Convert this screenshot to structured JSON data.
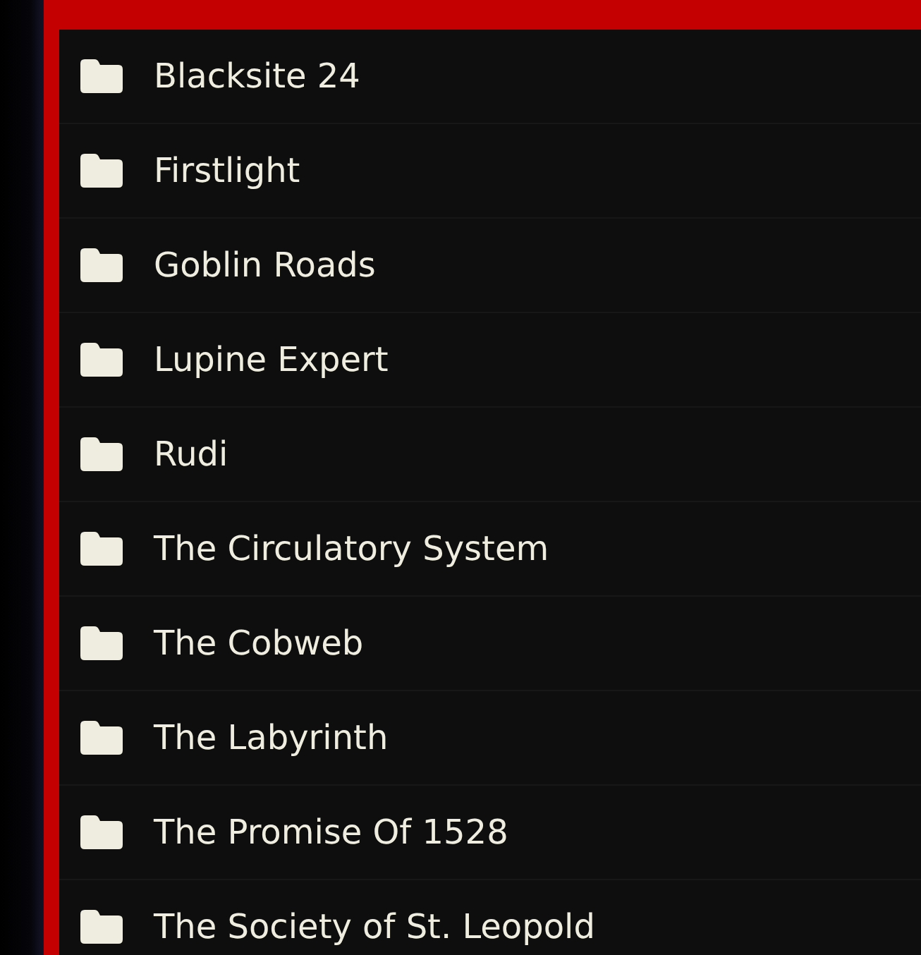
{
  "folders": [
    {
      "name": "Blacksite 24"
    },
    {
      "name": "Firstlight"
    },
    {
      "name": "Goblin Roads"
    },
    {
      "name": "Lupine Expert"
    },
    {
      "name": "Rudi"
    },
    {
      "name": "The Circulatory System"
    },
    {
      "name": "The Cobweb"
    },
    {
      "name": "The Labyrinth"
    },
    {
      "name": "The Promise Of 1528"
    },
    {
      "name": "The Society of St. Leopold"
    }
  ]
}
